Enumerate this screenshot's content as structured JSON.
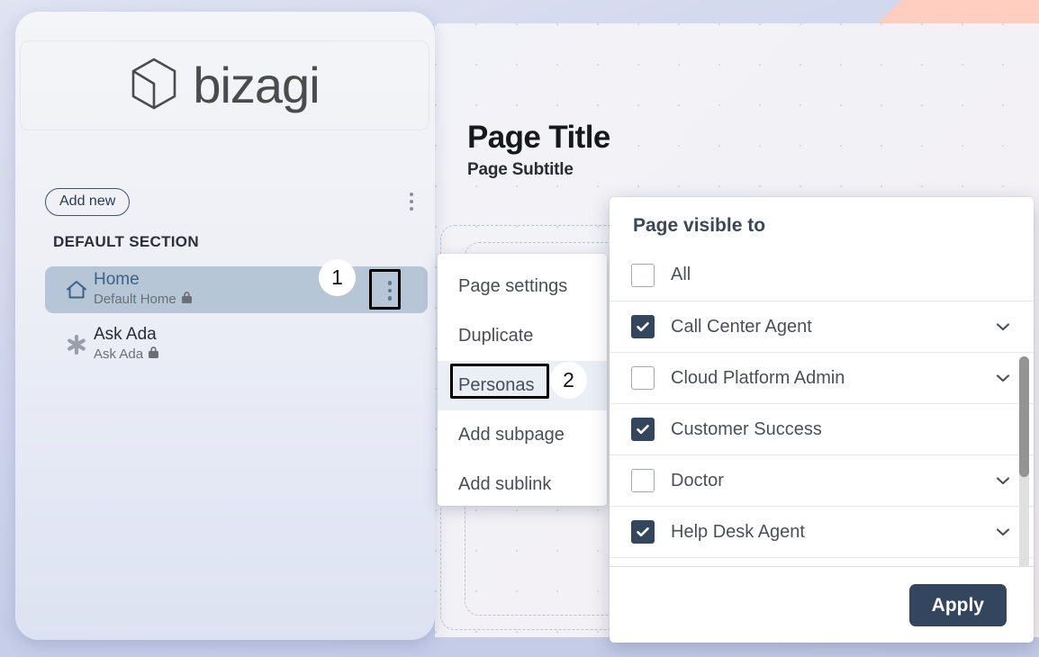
{
  "colors": {
    "accent_dark": "#33465e",
    "selected_row": "#b6c6d6",
    "coral_strip": "#ffcec0",
    "page_background": "#c9d0ea"
  },
  "sidebar": {
    "logo": {
      "mark": "bizagi-cube-icon",
      "wordmark": "bizagi"
    },
    "toolbar": {
      "add_new_label": "Add new",
      "more_icon": "kebab-menu-icon"
    },
    "section_label": "DEFAULT SECTION",
    "items": [
      {
        "icon": "home-icon",
        "title": "Home",
        "subtitle": "Default Home",
        "lock_icon": "lock-icon",
        "selected": true,
        "more_icon": "kebab-menu-icon"
      },
      {
        "icon": "asterisk-icon",
        "title": "Ask Ada",
        "subtitle": "Ask Ada",
        "lock_icon": "lock-icon",
        "selected": false
      }
    ]
  },
  "canvas": {
    "collapse_icon": "panel-collapse-left-icon",
    "page_title": "Page Title",
    "page_subtitle": "Page Subtitle"
  },
  "context_menu": {
    "items": [
      {
        "label": "Page settings",
        "hovered": false
      },
      {
        "label": "Duplicate",
        "hovered": false
      },
      {
        "label": "Personas",
        "hovered": true
      },
      {
        "label": "Add subpage",
        "hovered": false
      },
      {
        "label": "Add sublink",
        "hovered": false
      }
    ]
  },
  "personas_panel": {
    "title": "Page visible to",
    "rows": [
      {
        "label": "All",
        "checked": false,
        "has_chevron": false
      },
      {
        "label": "Call Center Agent",
        "checked": true,
        "has_chevron": true
      },
      {
        "label": "Cloud Platform Admin",
        "checked": false,
        "has_chevron": true
      },
      {
        "label": "Customer Success",
        "checked": true,
        "has_chevron": false
      },
      {
        "label": "Doctor",
        "checked": false,
        "has_chevron": true
      },
      {
        "label": "Help Desk Agent",
        "checked": true,
        "has_chevron": true
      }
    ],
    "chevron_icon": "chevron-down-icon",
    "checkbox_icon": "checkmark-icon",
    "apply_label": "Apply",
    "scrollbar": {
      "thumb_position_pct": 0,
      "thumb_size_pct": 46
    }
  },
  "annotations": [
    {
      "number": "1",
      "target": "home-row-kebab-menu"
    },
    {
      "number": "2",
      "target": "context-menu-personas-item"
    }
  ]
}
